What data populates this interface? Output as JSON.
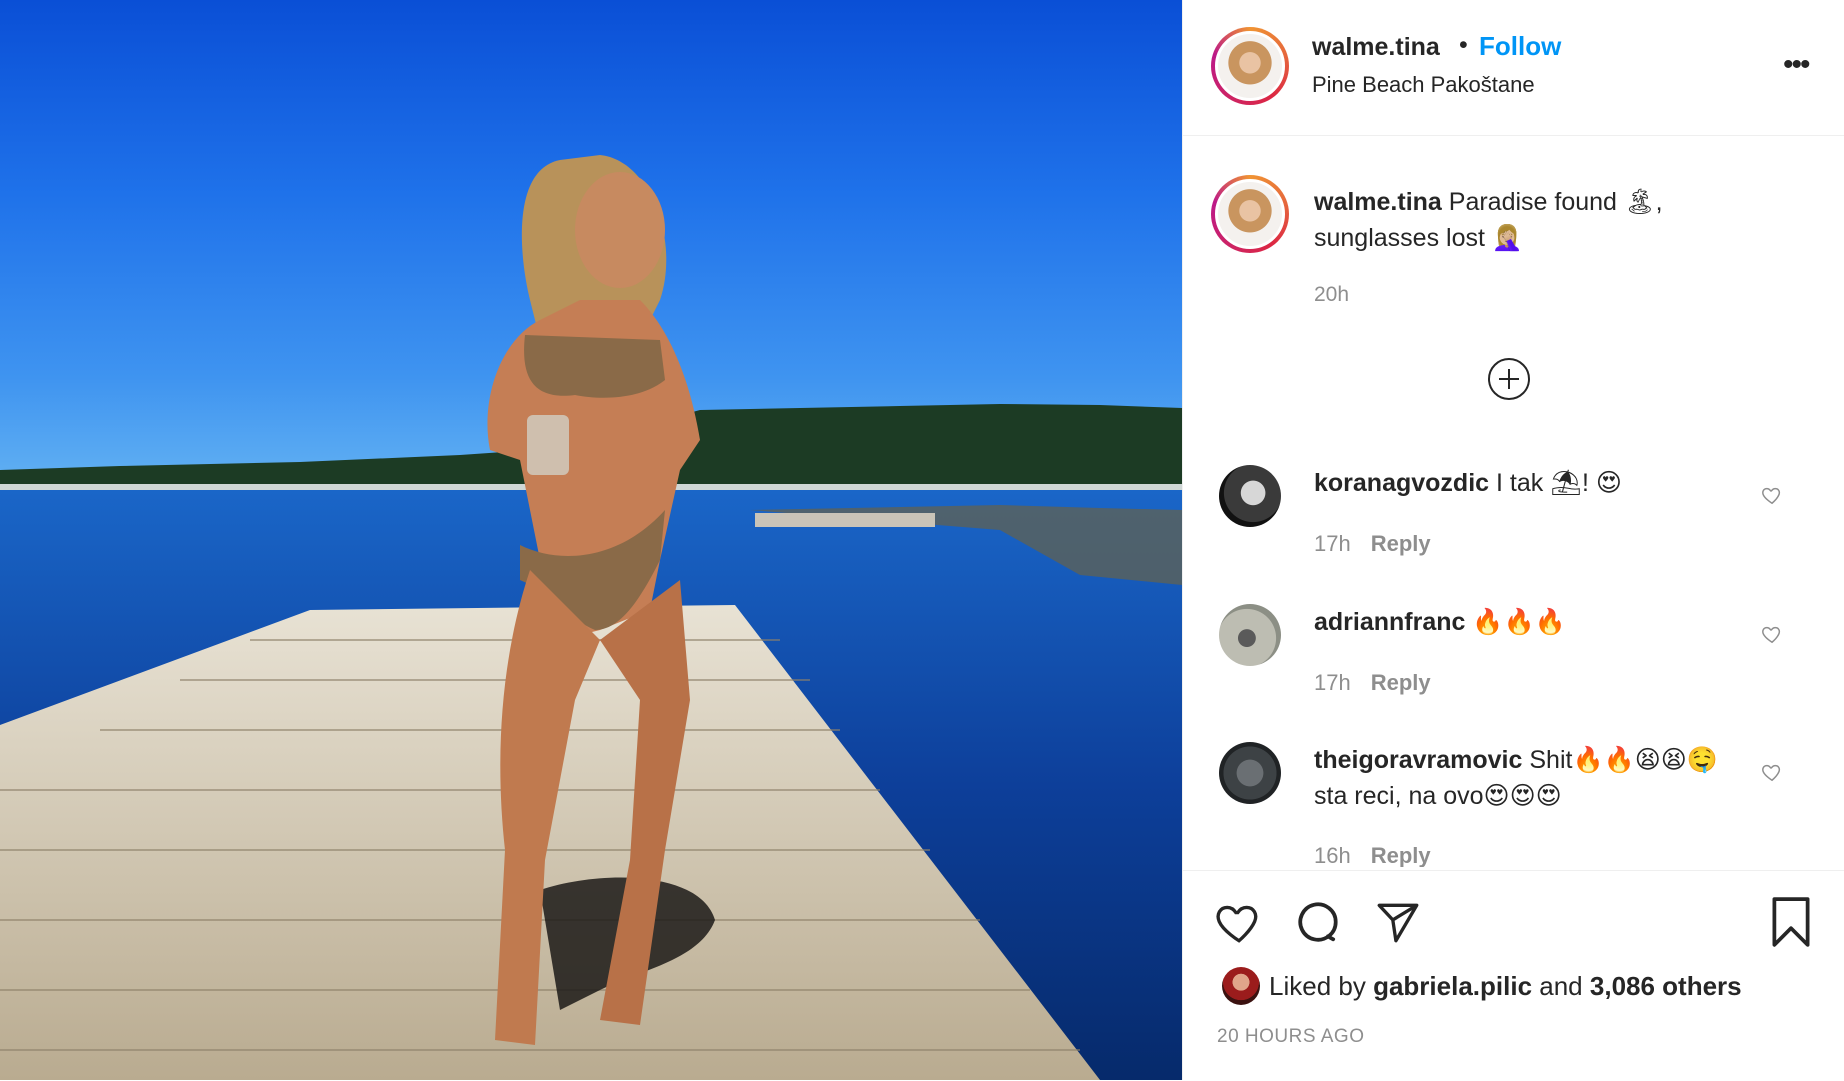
{
  "post": {
    "username": "walme.tina",
    "separator": "•",
    "follow_label": "Follow",
    "location": "Pine Beach Pakoštane",
    "more_label": "•••"
  },
  "caption": {
    "username": "walme.tina",
    "text": "Paradise found 🏝, sunglasses lost 🤦🏼‍♀️",
    "time": "20h"
  },
  "comments": [
    {
      "username": "koranagvozdic",
      "text": "I tak ⛱! 😍",
      "time": "17h",
      "reply_label": "Reply"
    },
    {
      "username": "adriannfranc",
      "text": "🔥🔥🔥",
      "time": "17h",
      "reply_label": "Reply"
    },
    {
      "username": "theigoravramovic",
      "text": "Shit🔥🔥😫😫🤤 sta reci, na ovo😍😍😍",
      "time": "16h",
      "reply_label": "Reply"
    }
  ],
  "likes": {
    "prefix": "Liked by",
    "user": "gabriela.pilic",
    "middle": "and",
    "others": "3,086 others"
  },
  "posted_ago": "20 HOURS AGO",
  "colors": {
    "accent": "#0095f6",
    "text": "#262626",
    "muted": "#8e8e8e"
  }
}
